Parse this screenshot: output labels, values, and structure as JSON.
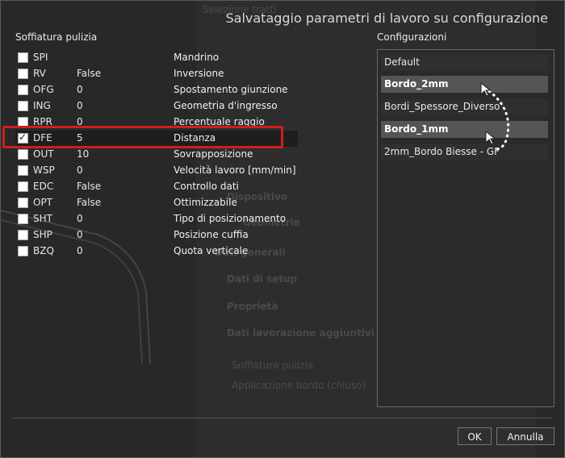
{
  "dialog": {
    "title": "Salvataggio parametri di lavoro su configurazione"
  },
  "params_section": {
    "heading": "Soffiatura pulizia",
    "rows": [
      {
        "code": "SPI",
        "value": "",
        "desc": "Mandrino",
        "checked": false
      },
      {
        "code": "RV",
        "value": "False",
        "desc": "Inversione",
        "checked": false
      },
      {
        "code": "OFG",
        "value": "0",
        "desc": "Spostamento giunzione",
        "checked": false
      },
      {
        "code": "ING",
        "value": "0",
        "desc": "Geometria d'ingresso",
        "checked": false
      },
      {
        "code": "RPR",
        "value": "0",
        "desc": "Percentuale raggio",
        "checked": false
      },
      {
        "code": "DFE",
        "value": "5",
        "desc": "Distanza",
        "checked": true
      },
      {
        "code": "OUT",
        "value": "10",
        "desc": "Sovrapposizione",
        "checked": false
      },
      {
        "code": "WSP",
        "value": "0",
        "desc": "Velocità lavoro [mm/min]",
        "checked": false
      },
      {
        "code": "EDC",
        "value": "False",
        "desc": "Controllo dati",
        "checked": false
      },
      {
        "code": "OPT",
        "value": "False",
        "desc": "Ottimizzabile",
        "checked": false
      },
      {
        "code": "SHT",
        "value": "0",
        "desc": "Tipo di posizionamento",
        "checked": false
      },
      {
        "code": "SHP",
        "value": "0",
        "desc": "Posizione cuffia",
        "checked": false
      },
      {
        "code": "BZQ",
        "value": "0",
        "desc": "Quota verticale",
        "checked": false
      }
    ]
  },
  "configs_section": {
    "heading": "Configurazioni",
    "items": [
      {
        "label": "Default",
        "selected": false
      },
      {
        "label": "Bordo_2mm",
        "selected": true
      },
      {
        "label": "Bordi_Spessore_Diverso",
        "selected": false
      },
      {
        "label": "Bordo_1mm",
        "selected": true
      },
      {
        "label": "2mm_Bordo Biesse - GF",
        "selected": false
      }
    ]
  },
  "buttons": {
    "ok": "OK",
    "cancel": "Annulla"
  },
  "ghost": {
    "lines": [
      "Selezione tratti",
      "Dati generali",
      "Dati di setup",
      "Proprietà",
      "Dati lavorazione aggiuntivi",
      "Soffiatura pulizia",
      "Applicazione bordo (chiuso)",
      "Dispositivo",
      "Geometrie"
    ]
  },
  "colors": {
    "highlight_border": "#d01e1e",
    "selected_item": "#555555",
    "background": "#282828"
  }
}
